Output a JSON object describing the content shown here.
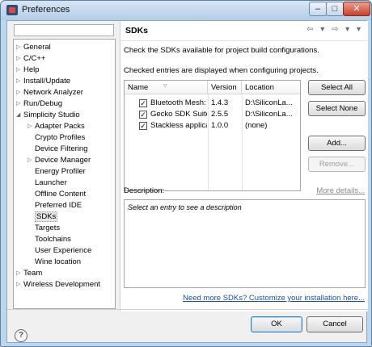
{
  "window": {
    "title": "Preferences",
    "minimize_glyph": "–",
    "maximize_glyph": "□",
    "close_glyph": "✕"
  },
  "sidebar": {
    "filter_placeholder": "",
    "items": [
      {
        "label": "General",
        "arrow": "▷"
      },
      {
        "label": "C/C++",
        "arrow": "▷"
      },
      {
        "label": "Help",
        "arrow": "▷"
      },
      {
        "label": "Install/Update",
        "arrow": "▷"
      },
      {
        "label": "Network Analyzer",
        "arrow": "▷"
      },
      {
        "label": "Run/Debug",
        "arrow": "▷"
      },
      {
        "label": "Simplicity Studio",
        "arrow": "◢"
      },
      {
        "label": "Adapter Packs",
        "arrow": "▷"
      },
      {
        "label": "Crypto Profiles",
        "arrow": ""
      },
      {
        "label": "Device Filtering",
        "arrow": ""
      },
      {
        "label": "Device Manager",
        "arrow": "▷"
      },
      {
        "label": "Energy Profiler",
        "arrow": ""
      },
      {
        "label": "Launcher",
        "arrow": ""
      },
      {
        "label": "Offline Content",
        "arrow": ""
      },
      {
        "label": "Preferred IDE",
        "arrow": ""
      },
      {
        "label": "SDKs",
        "arrow": ""
      },
      {
        "label": "Targets",
        "arrow": ""
      },
      {
        "label": "Toolchains",
        "arrow": ""
      },
      {
        "label": "User Experience",
        "arrow": ""
      },
      {
        "label": "Wine location",
        "arrow": ""
      },
      {
        "label": "Team",
        "arrow": "▷"
      },
      {
        "label": "Wireless Development",
        "arrow": "▷"
      }
    ],
    "selected": "SDKs"
  },
  "page": {
    "title": "SDKs",
    "nav_icons": "⇦ ▾ ⇨ ▾ ▾",
    "description_1": "Check the SDKs available for project build configurations.",
    "description_2": "Checked entries are displayed when configuring projects."
  },
  "table": {
    "columns": {
      "name": "Name",
      "version": "Version",
      "location": "Location"
    },
    "sort_indicator": "▽",
    "rows": [
      {
        "checked": true,
        "checkmark": "✓",
        "name": "Bluetooth Mesh: I",
        "version": "1.4.3",
        "location": "D:\\SiliconLa..."
      },
      {
        "checked": true,
        "checkmark": "✓",
        "name": "Gecko SDK Suite:",
        "version": "2.5.5",
        "location": "D:\\SiliconLa..."
      },
      {
        "checked": true,
        "checkmark": "✓",
        "name": "Stackless applicat",
        "version": "1.0.0",
        "location": "(none)"
      }
    ]
  },
  "buttons": {
    "select_all": "Select All",
    "select_none": "Select None",
    "add": "Add...",
    "remove": "Remove...",
    "ok": "OK",
    "cancel": "Cancel"
  },
  "description_section": {
    "label": "Description:",
    "more_details": "More details...",
    "placeholder": "Select an entry to see a description"
  },
  "links": {
    "need_more": "Need more SDKs?  Customize your installation here..."
  },
  "footer": {
    "help_glyph": "?"
  },
  "colors": {
    "window_frame": "#bcd6ee",
    "link": "#1a4fa0",
    "close_button": "#c8402c"
  }
}
